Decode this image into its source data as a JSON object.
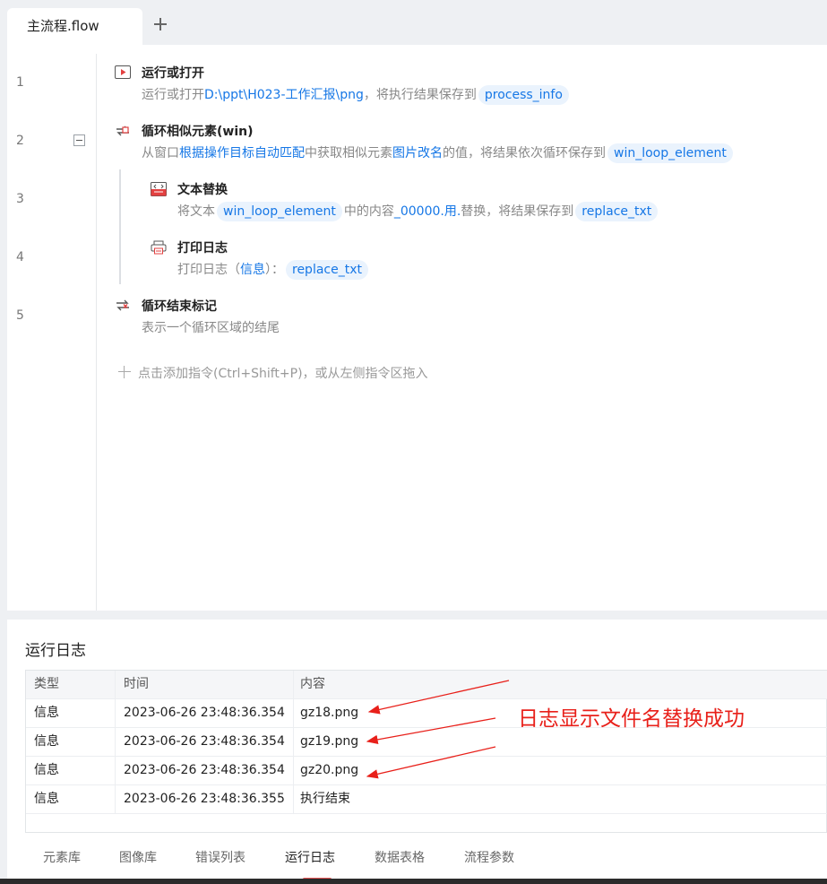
{
  "tabs": [
    {
      "label": "主流程.flow"
    }
  ],
  "line_numbers": [
    "1",
    "2",
    "3",
    "4",
    "5"
  ],
  "steps": [
    {
      "title": "运行或打开",
      "desc_prefix": "运行或打开",
      "desc_path": "D:\\ppt\\H023-工作汇报\\png",
      "desc_mid": "，将执行结果保存到",
      "var": "process_info"
    },
    {
      "title": "循环相似元素(win)",
      "desc_a": "从窗口",
      "desc_link1": "根据操作目标自动匹配",
      "desc_b": "中获取相似元素",
      "desc_link2": "图片改名",
      "desc_c": "的值，将结果依次循环保存到",
      "var": "win_loop_element"
    },
    {
      "title": "文本替换",
      "desc_a": "将文本",
      "var1": "win_loop_element",
      "desc_b": "中的内容",
      "desc_link": "_00000.用.",
      "desc_c": "替换，将结果保存到",
      "var2": "replace_txt"
    },
    {
      "title": "打印日志",
      "desc_a": "打印日志（",
      "desc_link": "信息",
      "desc_b": "）：",
      "var": "replace_txt"
    },
    {
      "title": "循环结束标记",
      "desc": "表示一个循环区域的结尾"
    }
  ],
  "add_instruction": "点击添加指令(Ctrl+Shift+P)，或从左侧指令区拖入",
  "log": {
    "title": "运行日志",
    "columns": [
      "类型",
      "时间",
      "内容"
    ],
    "rows": [
      {
        "type": "信息",
        "time": "2023-06-26 23:48:36.354",
        "content": "gz18.png"
      },
      {
        "type": "信息",
        "time": "2023-06-26 23:48:36.354",
        "content": "gz19.png"
      },
      {
        "type": "信息",
        "time": "2023-06-26 23:48:36.354",
        "content": "gz20.png"
      },
      {
        "type": "信息",
        "time": "2023-06-26 23:48:36.355",
        "content": "执行结束"
      }
    ]
  },
  "bottom_tabs": [
    "元素库",
    "图像库",
    "错误列表",
    "运行日志",
    "数据表格",
    "流程参数"
  ],
  "bottom_tab_active": "运行日志",
  "annotation": "日志显示文件名替换成功",
  "colors": {
    "link": "#1677e6",
    "annotation": "#e8201a",
    "tab_indicator": "#e55555"
  }
}
